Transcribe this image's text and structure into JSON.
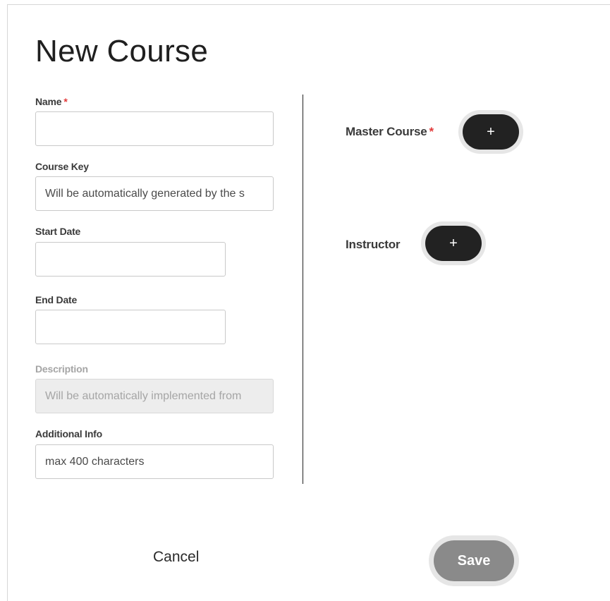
{
  "dialog": {
    "title": "New Course"
  },
  "form": {
    "name": {
      "label": "Name",
      "required_mark": "*",
      "value": ""
    },
    "course_key": {
      "label": "Course Key",
      "placeholder": "Will be automatically generated by the s"
    },
    "start_date": {
      "label": "Start Date",
      "value": ""
    },
    "end_date": {
      "label": "End Date",
      "value": ""
    },
    "description": {
      "label": "Description",
      "placeholder": "Will be automatically implemented from"
    },
    "additional_info": {
      "label": "Additional Info",
      "placeholder": "max 400 characters"
    }
  },
  "assignments": {
    "master_course": {
      "label": "Master Course",
      "required_mark": "*",
      "add_label": "+"
    },
    "instructor": {
      "label": "Instructor",
      "add_label": "+"
    }
  },
  "footer": {
    "cancel_label": "Cancel",
    "save_label": "Save"
  },
  "colors": {
    "required": "#e23a3a",
    "dark_button": "#222222",
    "save_button_disabled": "#8a8a8a"
  }
}
